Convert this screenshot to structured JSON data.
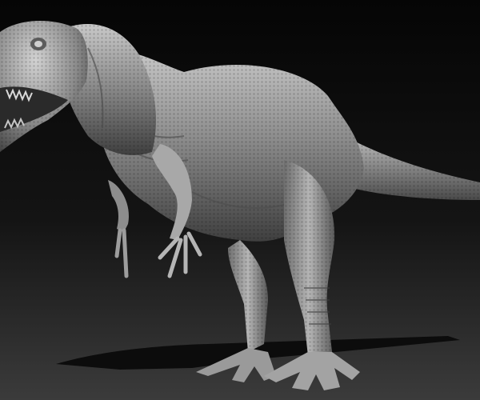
{
  "scene": {
    "subject": "dinosaur-sculpt",
    "colors": {
      "bg_top": "#070707",
      "bg_bottom": "#3a3a3a",
      "skin_light": "#cfcfcf",
      "skin_mid": "#8e8e8e",
      "skin_dark": "#3e3e3e",
      "shadow": "#0a0a0a"
    }
  }
}
